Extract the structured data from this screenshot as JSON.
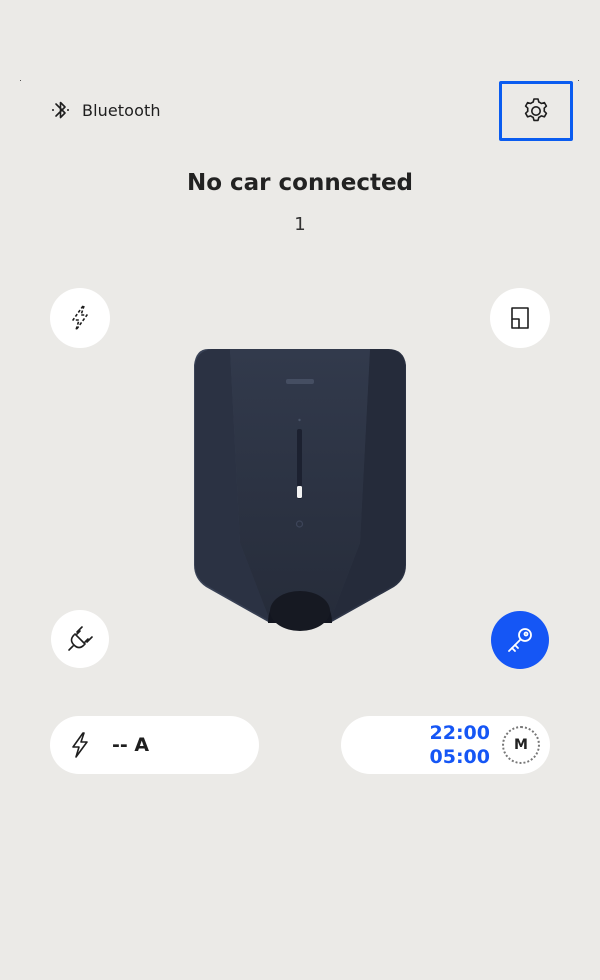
{
  "header": {
    "bluetooth_label": "Bluetooth",
    "bluetooth_icon": "bluetooth-icon",
    "settings_icon": "gear-icon"
  },
  "status": {
    "title": "No car connected",
    "subtitle": "1"
  },
  "actions": {
    "top_left_icon": "lightning-dashed-icon",
    "top_right_icon": "installation-box-icon",
    "bottom_left_icon": "plug-icon",
    "bottom_right_icon": "key-icon"
  },
  "current": {
    "icon": "lightning-icon",
    "value": "-- A"
  },
  "schedule": {
    "start": "22:00",
    "end": "05:00",
    "mode": "M"
  },
  "colors": {
    "background": "#ebeae7",
    "accent_blue": "#1556f5",
    "highlight_border": "#0a5cf0",
    "charger_body": "#2f3748"
  }
}
